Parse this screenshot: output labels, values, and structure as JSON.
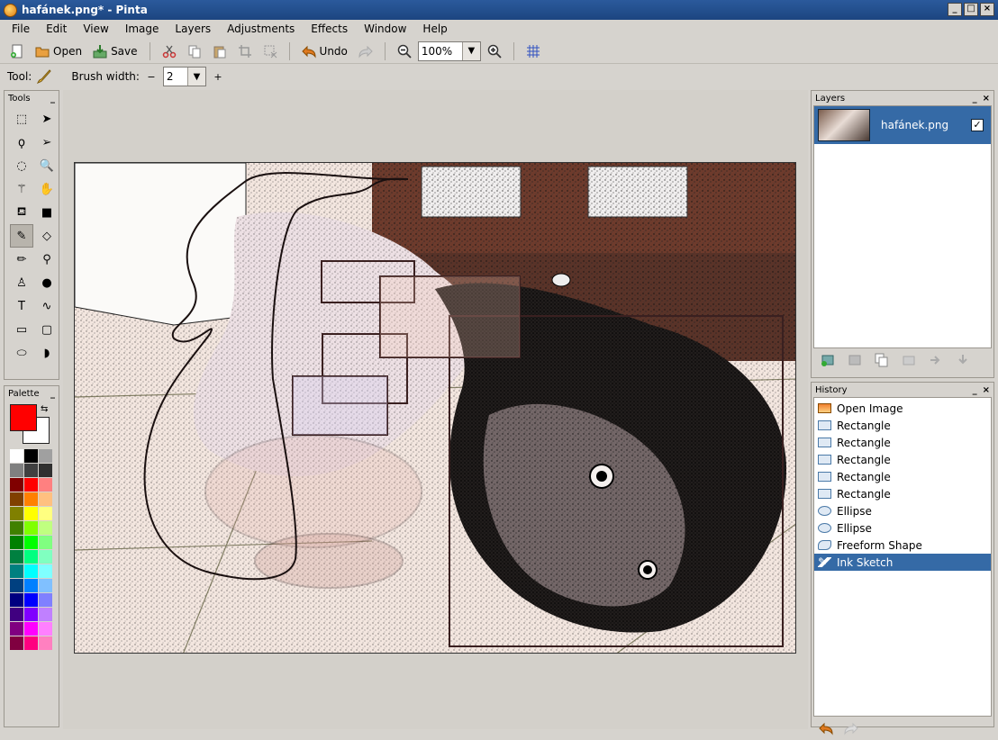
{
  "window": {
    "title": "hafánek.png* - Pinta",
    "controls": [
      "_",
      "□",
      "×"
    ]
  },
  "menu": [
    "File",
    "Edit",
    "View",
    "Image",
    "Layers",
    "Adjustments",
    "Effects",
    "Window",
    "Help"
  ],
  "toolbar": {
    "open_label": "Open",
    "save_label": "Save",
    "undo_label": "Undo",
    "zoom_value": "100%"
  },
  "tool_options": {
    "tool_label": "Tool:",
    "brush_width_label": "Brush width:",
    "brush_width_value": "2",
    "minus": "−",
    "plus": "+"
  },
  "panels": {
    "tools_title": "Tools",
    "palette_title": "Palette",
    "layers_title": "Layers",
    "history_title": "History"
  },
  "tools": [
    {
      "name": "rectangle-select-icon",
      "glyph": "⬚"
    },
    {
      "name": "move-selected-icon",
      "glyph": "➤"
    },
    {
      "name": "lasso-select-icon",
      "glyph": "ϙ"
    },
    {
      "name": "move-selection-icon",
      "glyph": "➢"
    },
    {
      "name": "ellipse-select-icon",
      "glyph": "◌"
    },
    {
      "name": "zoom-icon",
      "glyph": "🔍"
    },
    {
      "name": "magic-wand-icon",
      "glyph": "⚚"
    },
    {
      "name": "pan-icon",
      "glyph": "✋"
    },
    {
      "name": "paint-bucket-icon",
      "glyph": "⛾"
    },
    {
      "name": "gradient-icon",
      "glyph": "■"
    },
    {
      "name": "paintbrush-icon",
      "glyph": "✎"
    },
    {
      "name": "eraser-icon",
      "glyph": "◇"
    },
    {
      "name": "pencil-icon",
      "glyph": "✏"
    },
    {
      "name": "color-picker-icon",
      "glyph": "⚲"
    },
    {
      "name": "clone-stamp-icon",
      "glyph": "♙"
    },
    {
      "name": "recolor-icon",
      "glyph": "●"
    },
    {
      "name": "text-icon",
      "glyph": "T"
    },
    {
      "name": "line-curve-icon",
      "glyph": "∿"
    },
    {
      "name": "rectangle-icon",
      "glyph": "▭"
    },
    {
      "name": "rounded-rectangle-icon",
      "glyph": "▢"
    },
    {
      "name": "ellipse-icon",
      "glyph": "⬭"
    },
    {
      "name": "freeform-shape-icon",
      "glyph": "◗"
    }
  ],
  "colors": {
    "primary": "#ff0000",
    "secondary": "#ffffff",
    "palette": [
      "#ffffff",
      "#000000",
      "#a0a0a0",
      "#808080",
      "#404040",
      "#303030",
      "#800000",
      "#ff0000",
      "#ff8080",
      "#804000",
      "#ff8000",
      "#ffc080",
      "#808000",
      "#ffff00",
      "#ffff80",
      "#408000",
      "#80ff00",
      "#c0ff80",
      "#008000",
      "#00ff00",
      "#80ff80",
      "#008040",
      "#00ff80",
      "#80ffc0",
      "#008080",
      "#00ffff",
      "#80ffff",
      "#004080",
      "#0080ff",
      "#80c0ff",
      "#000080",
      "#0000ff",
      "#8080ff",
      "#400080",
      "#8000ff",
      "#c080ff",
      "#800080",
      "#ff00ff",
      "#ff80ff",
      "#800040",
      "#ff0080",
      "#ff80c0"
    ]
  },
  "layers": [
    {
      "name": "hafánek.png",
      "visible_mark": "✓"
    }
  ],
  "history": [
    {
      "label": "Open Image",
      "icon": "img"
    },
    {
      "label": "Rectangle",
      "icon": "rect"
    },
    {
      "label": "Rectangle",
      "icon": "rect"
    },
    {
      "label": "Rectangle",
      "icon": "rect"
    },
    {
      "label": "Rectangle",
      "icon": "rect"
    },
    {
      "label": "Rectangle",
      "icon": "rect"
    },
    {
      "label": "Ellipse",
      "icon": "ell"
    },
    {
      "label": "Ellipse",
      "icon": "ell"
    },
    {
      "label": "Freeform Shape",
      "icon": "free"
    },
    {
      "label": "Ink Sketch",
      "icon": "ink",
      "selected": true
    }
  ]
}
